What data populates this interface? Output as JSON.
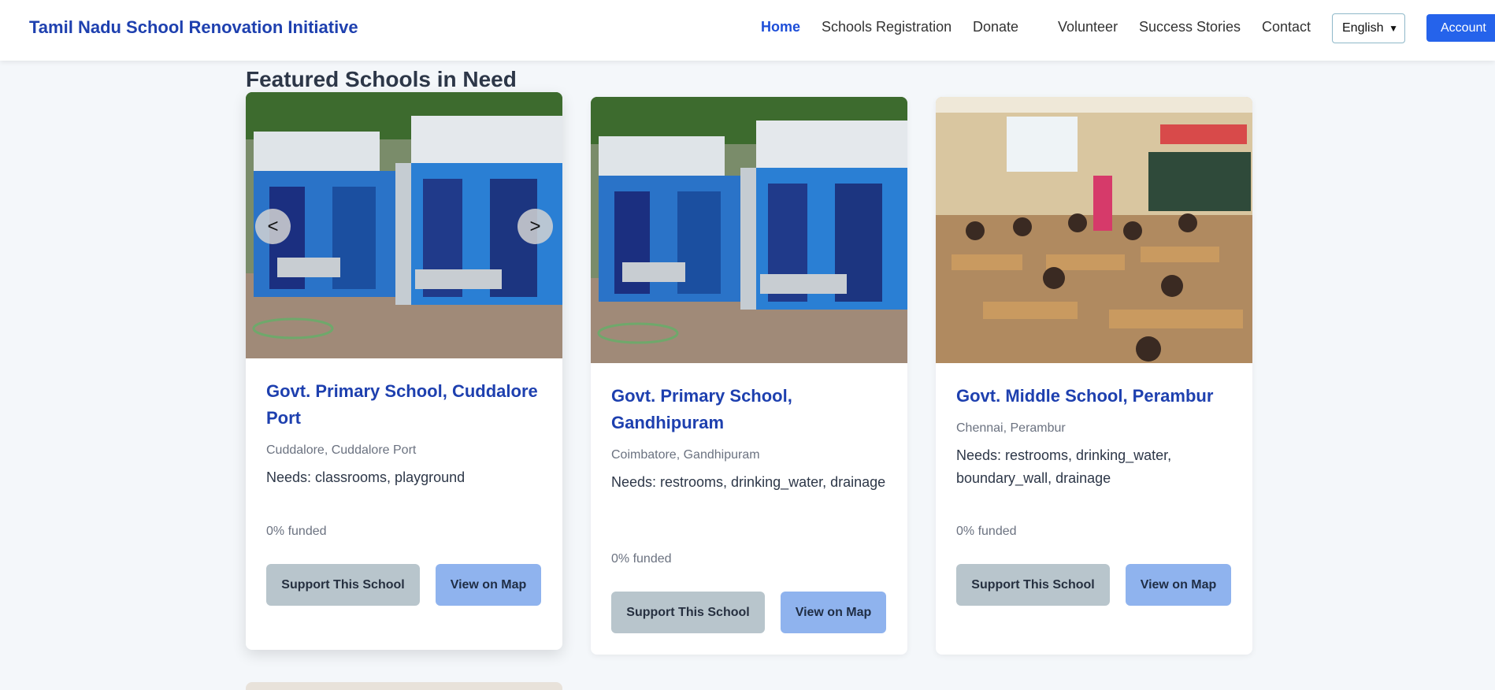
{
  "header": {
    "brand": "Tamil Nadu School Renovation Initiative",
    "nav": [
      {
        "label": "Home",
        "active": true
      },
      {
        "label": "Schools Registration",
        "active": false
      },
      {
        "label": "Donate",
        "active": false
      },
      {
        "label": "Volunteer",
        "active": false
      },
      {
        "label": "Success Stories",
        "active": false
      },
      {
        "label": "Contact",
        "active": false
      }
    ],
    "language": "English",
    "account_label": "Account"
  },
  "section": {
    "title": "Featured Schools in Need"
  },
  "cards": [
    {
      "title": "Govt. Primary School, Cuddalore Port",
      "location": "Cuddalore, Cuddalore Port",
      "needs": "Needs: classrooms, playground",
      "funded": "0% funded",
      "support_label": "Support This School",
      "map_label": "View on Map",
      "image": "restroom-blocks-photo",
      "carousel": {
        "prev": "<",
        "next": ">"
      }
    },
    {
      "title": "Govt. Primary School, Gandhipuram",
      "location": "Coimbatore, Gandhipuram",
      "needs": "Needs: restrooms, drinking_water, drainage",
      "funded": "0% funded",
      "support_label": "Support This School",
      "map_label": "View on Map",
      "image": "restroom-blocks-photo"
    },
    {
      "title": "Govt. Middle School, Perambur",
      "location": "Chennai, Perambur",
      "needs": "Needs: restrooms, drinking_water, boundary_wall, drainage",
      "funded": "0% funded",
      "support_label": "Support This School",
      "map_label": "View on Map",
      "image": "classroom-students-photo"
    }
  ],
  "colors": {
    "brand": "#1e40af",
    "accent": "#2563eb",
    "support_button": "#b8c5cc",
    "map_button": "#8fb3ee",
    "background": "#f4f7fa"
  }
}
